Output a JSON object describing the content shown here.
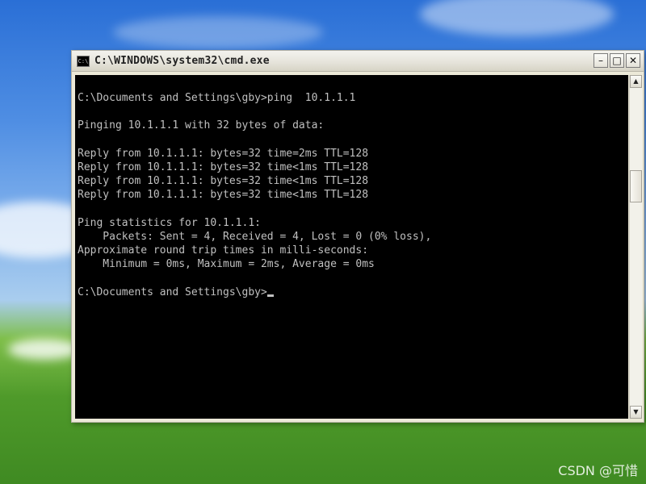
{
  "window": {
    "title": "C:\\WINDOWS\\system32\\cmd.exe",
    "icon": "cmd-icon",
    "controls": [
      "minimize-icon",
      "maximize-icon",
      "close-icon"
    ]
  },
  "console": {
    "lines": [
      "C:\\Documents and Settings\\gby>ping  10.1.1.1",
      "",
      "Pinging 10.1.1.1 with 32 bytes of data:",
      "",
      "Reply from 10.1.1.1: bytes=32 time=2ms TTL=128",
      "Reply from 10.1.1.1: bytes=32 time<1ms TTL=128",
      "Reply from 10.1.1.1: bytes=32 time<1ms TTL=128",
      "Reply from 10.1.1.1: bytes=32 time<1ms TTL=128",
      "",
      "Ping statistics for 10.1.1.1:",
      "    Packets: Sent = 4, Received = 4, Lost = 0 (0% loss),",
      "Approximate round trip times in milli-seconds:",
      "    Minimum = 0ms, Maximum = 2ms, Average = 0ms",
      ""
    ],
    "prompt": "C:\\Documents and Settings\\gby>"
  },
  "watermark": "CSDN @可惜"
}
